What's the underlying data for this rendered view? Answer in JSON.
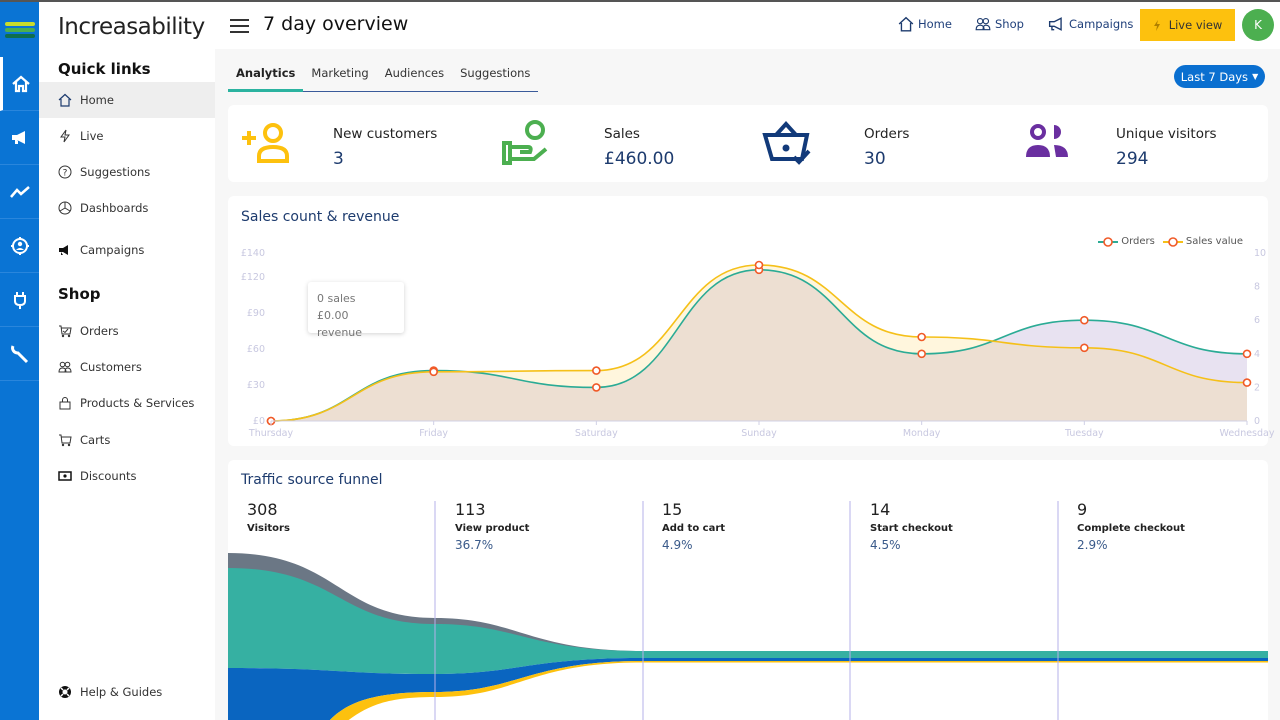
{
  "app": {
    "brand": "Increasability",
    "page_title": "7 day overview"
  },
  "rail": {
    "items": [
      "home",
      "campaigns",
      "analytics",
      "audiences",
      "integrations",
      "tools"
    ]
  },
  "sidebar": {
    "quick_links_title": "Quick links",
    "quick_links": [
      {
        "label": "Home",
        "icon": "home-icon"
      },
      {
        "label": "Live",
        "icon": "bolt-icon"
      },
      {
        "label": "Suggestions",
        "icon": "question-icon"
      },
      {
        "label": "Dashboards",
        "icon": "pie-icon"
      },
      {
        "label": "Campaigns",
        "icon": "megaphone-icon"
      }
    ],
    "shop_title": "Shop",
    "shop_links": [
      {
        "label": "Orders",
        "icon": "cart-check-icon"
      },
      {
        "label": "Customers",
        "icon": "users-icon"
      },
      {
        "label": "Products & Services",
        "icon": "bag-icon"
      },
      {
        "label": "Carts",
        "icon": "cart-icon"
      },
      {
        "label": "Discounts",
        "icon": "ticket-icon"
      }
    ],
    "help": "Help & Guides"
  },
  "topbar": {
    "home": "Home",
    "shop": "Shop",
    "campaigns": "Campaigns",
    "live_view": "Live view",
    "avatar": "K",
    "live_color": "#fdc10e",
    "avatar_color": "#4caf50"
  },
  "tabs": [
    "Analytics",
    "Marketing",
    "Audiences",
    "Suggestions"
  ],
  "range": "Last 7 Days",
  "stats": [
    {
      "label": "New customers",
      "value": "3",
      "color": "#fdc10e"
    },
    {
      "label": "Sales",
      "value": "£460.00",
      "color": "#4caf50"
    },
    {
      "label": "Orders",
      "value": "30",
      "color": "#123a7a"
    },
    {
      "label": "Unique visitors",
      "value": "294",
      "color": "#6a2fa0"
    }
  ],
  "sales_chart": {
    "title": "Sales count & revenue",
    "tooltip": {
      "line1": "0 sales",
      "line2": "£0.00 revenue"
    },
    "legend": {
      "orders": "Orders",
      "sales": "Sales value"
    }
  },
  "chart_data": {
    "type": "area",
    "categories": [
      "Thursday",
      "Friday",
      "Saturday",
      "Sunday",
      "Monday",
      "Tuesday",
      "Wednesday"
    ],
    "left_axis": {
      "ticks": [
        "£0",
        "£30",
        "£60",
        "£90",
        "£120",
        "£140"
      ],
      "tick_values": [
        0,
        30,
        60,
        90,
        120,
        140
      ],
      "range": [
        0,
        140
      ]
    },
    "right_axis": {
      "ticks": [
        "0",
        "2",
        "4",
        "6",
        "8",
        "10"
      ],
      "tick_values": [
        0,
        2,
        4,
        6,
        8,
        10
      ],
      "range": [
        0,
        10
      ]
    },
    "series": [
      {
        "name": "Orders",
        "axis": "right",
        "color": "#2bab95",
        "values": [
          0,
          3,
          2,
          9,
          4,
          6,
          4
        ]
      },
      {
        "name": "Sales value",
        "axis": "left",
        "color": "#f5c019",
        "values": [
          0,
          41,
          42,
          130,
          70,
          61,
          32
        ]
      }
    ],
    "legend": "top-right",
    "grid": false
  },
  "funnel": {
    "title": "Traffic source funnel",
    "steps": [
      {
        "count": "308",
        "label": "Visitors",
        "pct": ""
      },
      {
        "count": "113",
        "label": "View product",
        "pct": "36.7%"
      },
      {
        "count": "15",
        "label": "Add to cart",
        "pct": "4.9%"
      },
      {
        "count": "14",
        "label": "Start checkout",
        "pct": "4.5%"
      },
      {
        "count": "9",
        "label": "Complete checkout",
        "pct": "2.9%"
      }
    ],
    "colors": [
      "#6b7785",
      "#36b0a2",
      "#0a65c0",
      "#fdc10e"
    ]
  }
}
